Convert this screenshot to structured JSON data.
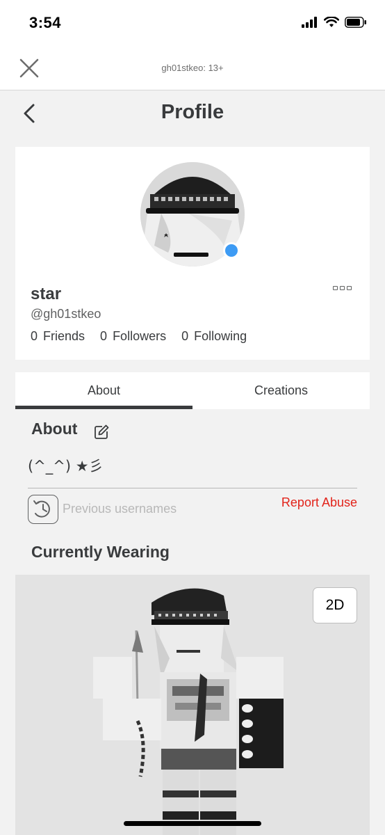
{
  "status_bar": {
    "time": "3:54",
    "icons": [
      "cellular-signal-icon",
      "wifi-icon",
      "battery-icon"
    ]
  },
  "web_header": {
    "title": "gh01stkeo: 13+",
    "close_icon": "close-icon"
  },
  "page_header": {
    "title": "Profile",
    "back_icon": "chevron-left-icon"
  },
  "profile": {
    "display_name": "star",
    "username": "@gh01stkeo",
    "presence_color": "#3d9bf4",
    "stats": [
      {
        "count": "0",
        "label": "Friends"
      },
      {
        "count": "0",
        "label": "Followers"
      },
      {
        "count": "0",
        "label": "Following"
      }
    ],
    "more_icon": "more-options-icon"
  },
  "tabs": [
    {
      "label": "About",
      "active": true
    },
    {
      "label": "Creations",
      "active": false
    }
  ],
  "about": {
    "heading": "About",
    "edit_icon": "edit-icon",
    "bio": "(^_^) ★彡",
    "previous_usernames_label": "Previous usernames",
    "history_icon": "history-icon",
    "report_label": "Report Abuse",
    "report_color": "#e2231a"
  },
  "wearing": {
    "heading": "Currently Wearing",
    "toggle_label": "2D"
  }
}
